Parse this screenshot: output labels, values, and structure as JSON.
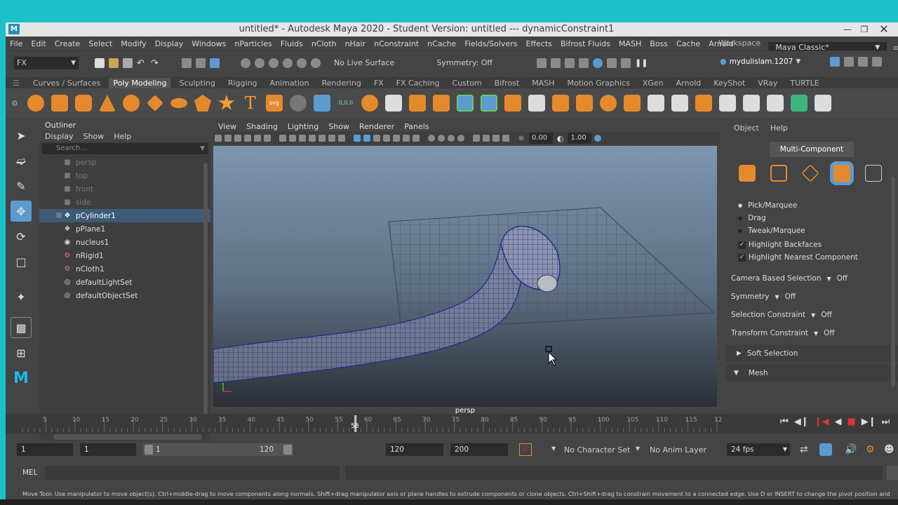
{
  "window": {
    "title": "untitled* - Autodesk Maya 2020 - Student Version: untitled    ---   dynamicConstraint1",
    "logo": "M"
  },
  "menubar": [
    "File",
    "Edit",
    "Create",
    "Select",
    "Modify",
    "Display",
    "Windows",
    "nParticles",
    "Fluids",
    "nCloth",
    "nHair",
    "nConstraint",
    "nCache",
    "Fields/Solvers",
    "Effects",
    "Bifrost Fluids",
    "MASH",
    "Boss",
    "Cache",
    "Arnold"
  ],
  "workspace": {
    "label": "Workspace :",
    "value": "Maya Classic*"
  },
  "statusline": {
    "menuset": "FX",
    "live_surface": "No Live Surface",
    "symmetry": "Symmetry: Off",
    "user": "mydulislam.1207"
  },
  "shelf_tabs": [
    "Curves / Surfaces",
    "Poly Modeling",
    "Sculpting",
    "Rigging",
    "Animation",
    "Rendering",
    "FX",
    "FX Caching",
    "Custom",
    "Bifrost",
    "MASH",
    "Motion Graphics",
    "XGen",
    "Arnold",
    "KeyShot",
    "VRay",
    "TURTLE"
  ],
  "shelf_active": "Poly Modeling",
  "shelf_icons": {
    "text_tool": "T",
    "svg_tool": "svg",
    "coords": "0,0,0"
  },
  "outliner": {
    "title": "Outliner",
    "menu": [
      "Display",
      "Show",
      "Help"
    ],
    "search_placeholder": "Search...",
    "items": [
      {
        "name": "persp",
        "icon": "camera-icon"
      },
      {
        "name": "top",
        "icon": "camera-icon"
      },
      {
        "name": "front",
        "icon": "camera-icon"
      },
      {
        "name": "side",
        "icon": "camera-icon"
      },
      {
        "name": "pCylinder1",
        "icon": "mesh-icon"
      },
      {
        "name": "pPlane1",
        "icon": "mesh-icon"
      },
      {
        "name": "nucleus1",
        "icon": "nucleus-icon"
      },
      {
        "name": "nRigid1",
        "icon": "nrigid-icon"
      },
      {
        "name": "nCloth1",
        "icon": "ncloth-icon"
      },
      {
        "name": "defaultLightSet",
        "icon": "set-icon"
      },
      {
        "name": "defaultObjectSet",
        "icon": "set-icon"
      }
    ]
  },
  "viewport": {
    "menu": [
      "View",
      "Shading",
      "Lighting",
      "Show",
      "Renderer",
      "Panels"
    ],
    "near": "0.00",
    "far": "1.00",
    "camera_label": "persp"
  },
  "toolkit": {
    "menu": [
      "Object",
      "Help"
    ],
    "mode": "Multi-Component",
    "pick_marquee": "Pick/Marquee",
    "drag": "Drag",
    "tweak_marquee": "Tweak/Marquee",
    "highlight_backfaces": "Highlight Backfaces",
    "highlight_nearest": "Highlight Nearest Component",
    "camera_based": {
      "label": "Camera Based Selection",
      "value": "Off"
    },
    "symmetry": {
      "label": "Symmetry",
      "value": "Off"
    },
    "selection_constraint": {
      "label": "Selection Constraint",
      "value": "Off"
    },
    "transform_constraint": {
      "label": "Transform Constraint",
      "value": "Off"
    },
    "soft_selection": "Soft Selection",
    "mesh": "Mesh"
  },
  "timeline": {
    "ticks": [
      "5",
      "10",
      "15",
      "20",
      "25",
      "30",
      "35",
      "40",
      "45",
      "50",
      "55",
      "60",
      "65",
      "70",
      "75",
      "80",
      "85",
      "90",
      "95",
      "100",
      "105",
      "110",
      "115",
      "12"
    ],
    "current_frame": "58",
    "current_frame_value": 58,
    "start": 1,
    "end": 120
  },
  "range": {
    "start": "1",
    "anim_start": "1",
    "slider_start": "1",
    "slider_end": "120",
    "end": "120",
    "anim_end": "200",
    "character_set": "No Character Set",
    "anim_layer": "No Anim Layer",
    "fps": "24 fps"
  },
  "cmdline": {
    "lang": "MEL"
  },
  "helpline": "Move Tool: Use manipulator to move object(s). Ctrl+middle-drag to move components along normals. Shift+drag manipulator axis or plane handles to extrude components or clone objects. Ctrl+Shift+drag to constrain movement to a connected edge. Use D or INSERT to change the pivot position and",
  "colors": {
    "accent": "#5b9bd0",
    "selection": "#3d5b77",
    "timeline_marker": "#c8c8c8",
    "record": "#e23030"
  }
}
